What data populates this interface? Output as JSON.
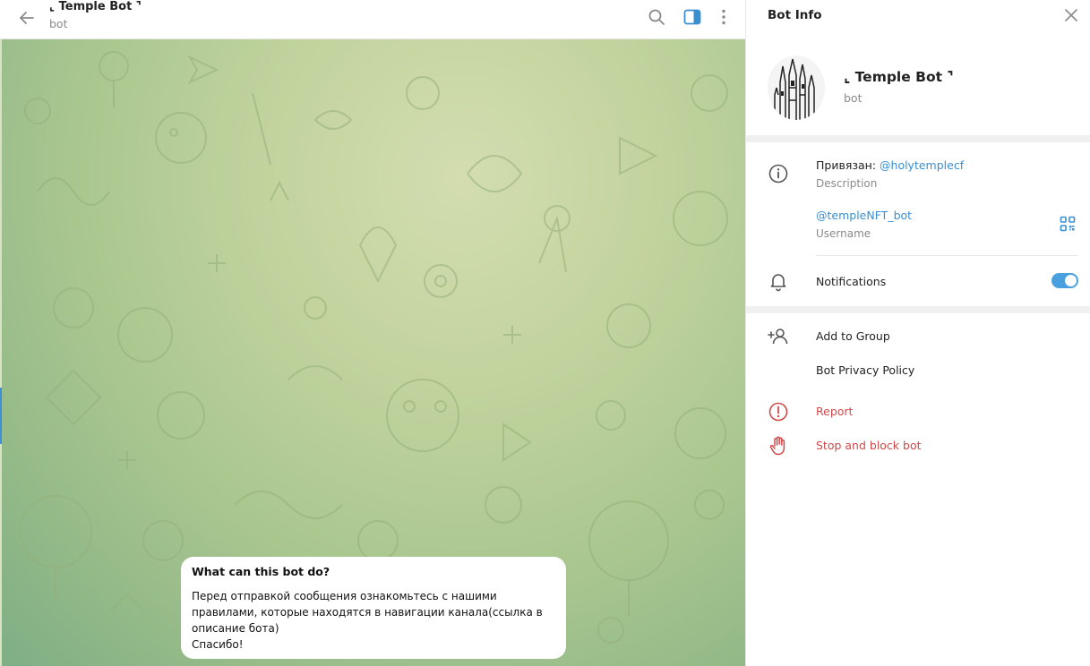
{
  "header": {
    "title": "⌞ Temple Bot ⌝",
    "subtitle": "bot",
    "icons": [
      "back-arrow-icon",
      "search-icon",
      "sidebar-toggle-icon",
      "more-vertical-icon"
    ]
  },
  "message": {
    "title": "What can this bot do?",
    "text": "Перед отправкой сообщения ознакомьтесь с нашими\nправилами, которые находятся в навигации канала(ссылка в\nописание бота)\nСпасибо!"
  },
  "panel": {
    "title": "Bot Info",
    "bot_name": "⌞ Temple Bot ⌝",
    "bot_subtitle": "bot",
    "description_prefix": "Привязан: ",
    "description_link": "@holytemplecf",
    "description_label": "Description",
    "username": "@templeNFT_bot",
    "username_label": "Username",
    "notifications_label": "Notifications",
    "notifications_on": true,
    "actions": {
      "add_to_group": "Add to Group",
      "privacy_policy": "Bot Privacy Policy",
      "report": "Report",
      "stop_block": "Stop and block bot"
    }
  },
  "colors": {
    "accent": "#3a8fd0",
    "danger": "#d0494b",
    "toggle": "#4aa0de"
  }
}
